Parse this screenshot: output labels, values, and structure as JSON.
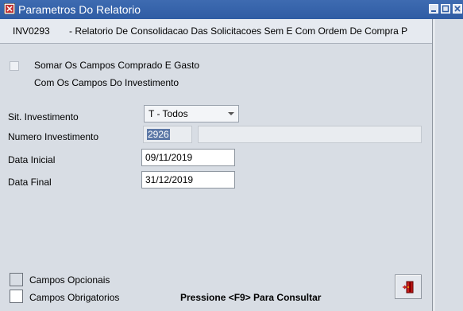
{
  "window": {
    "title": "Parametros Do Relatorio",
    "controls": [
      "minimize-icon",
      "maximize-icon",
      "close-icon"
    ]
  },
  "header": {
    "code": "INV0293",
    "description": "- Relatorio De Consolidacao Das Solicitacoes Sem E Com Ordem De Compra P"
  },
  "form": {
    "somar_checkbox": {
      "checked": false,
      "label_line1": "Somar Os Campos Comprado E Gasto",
      "label_line2": "Com Os Campos Do Investimento"
    },
    "sit_investimento": {
      "label": "Sit. Investimento",
      "value": "T - Todos"
    },
    "numero_investimento": {
      "label": "Numero Investimento",
      "value": "2926",
      "description": ""
    },
    "data_inicial": {
      "label": "Data Inicial",
      "value": "09/11/2019"
    },
    "data_final": {
      "label": "Data Final",
      "value": "31/12/2019"
    }
  },
  "legend": {
    "optional": "Campos Opcionais",
    "required": "Campos Obrigatorios",
    "optional_color": "#d8dde4",
    "required_color": "#ffffff"
  },
  "footer": {
    "hint": "Pressione <F9> Para Consultar",
    "exit_icon": "exit-door-icon"
  }
}
